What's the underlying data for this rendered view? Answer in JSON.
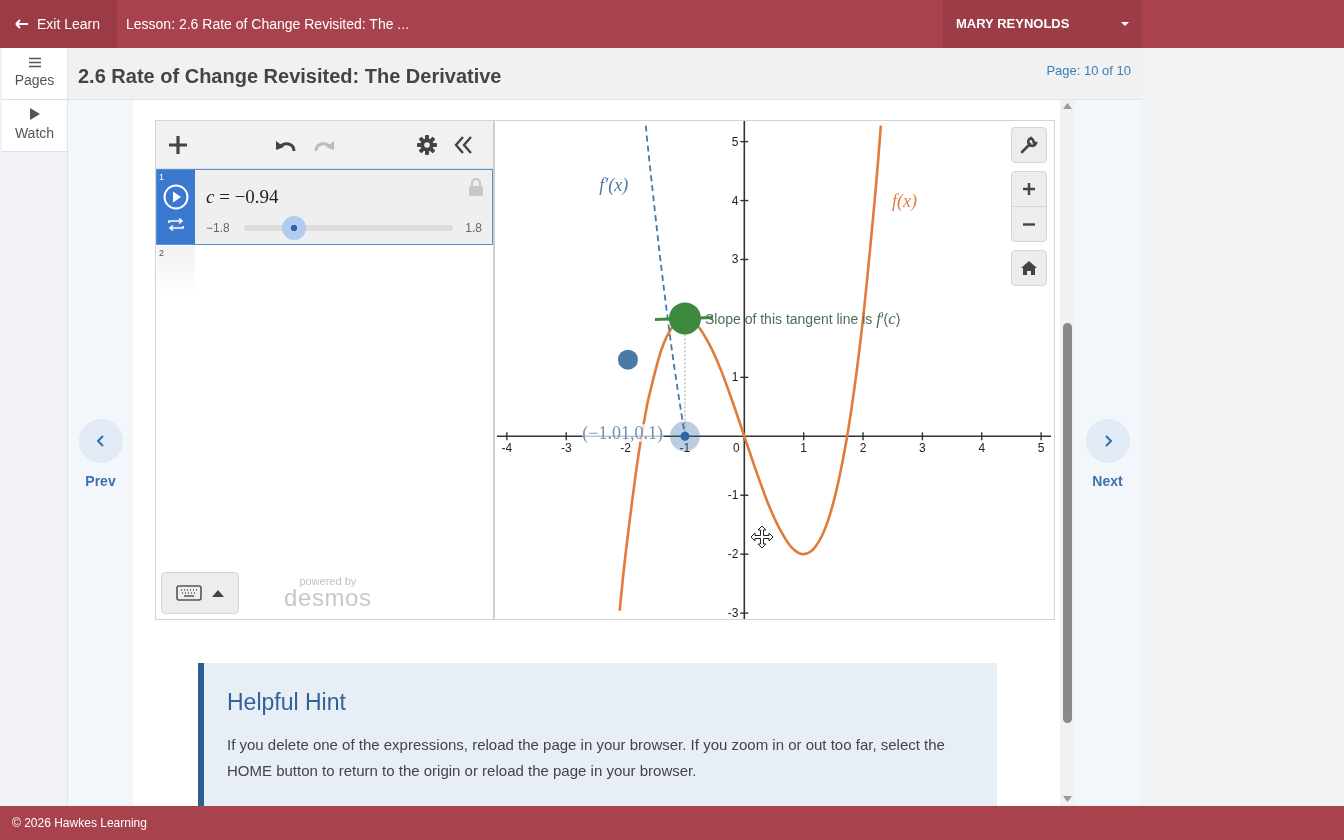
{
  "top_bar": {
    "exit_label": "Exit Learn",
    "lesson_title": "Lesson: 2.6 Rate of Change Revisited: The ...",
    "user_name": "MARY REYNOLDS"
  },
  "sidebar": {
    "items": [
      {
        "label": "Pages",
        "kind": "menu"
      },
      {
        "label": "Watch",
        "kind": "play"
      }
    ]
  },
  "header": {
    "title": "2.6 Rate of Change Revisited: The Derivative",
    "page_indicator": "Page: 10 of 10"
  },
  "navigation": {
    "prev": "Prev",
    "next": "Next"
  },
  "calculator": {
    "expressions": [
      {
        "index": "1",
        "kind": "slider",
        "selected": true,
        "latex": "*c* = −0.94",
        "min": "−1.8",
        "max": "1.8",
        "level": 0.24,
        "locked": true
      },
      {
        "index": "2",
        "kind": "empty",
        "selected": false
      }
    ],
    "powered_by": "powered by",
    "brand": "desmos",
    "chart_data": {
      "type": "line",
      "x": [
        -2.1,
        -2.0,
        -1.8,
        -1.66,
        -1.6,
        -1.4,
        -1.2,
        -1.0,
        -0.8,
        -0.6,
        -0.4,
        -0.2,
        0,
        0.2,
        0.4,
        0.6,
        0.8,
        1.0,
        1.2,
        1.4,
        1.6,
        1.8,
        2.0,
        2.2,
        2.3
      ],
      "series": [
        {
          "name": "f(x)",
          "color": "#e07b39",
          "values": [
            -2.96,
            -2,
            -0.43,
            0.41,
            0.7,
            1.46,
            1.87,
            2,
            1.89,
            1.58,
            1.14,
            0.59,
            0,
            -0.59,
            -1.14,
            -1.58,
            -1.89,
            -2,
            -1.87,
            -1.46,
            -0.7,
            0.43,
            2,
            4.05,
            5.27
          ]
        },
        {
          "name": "f′(x)",
          "color": "#4a77a4",
          "line_style": "dashed",
          "values": [
            null,
            null,
            null,
            5.27,
            4.68,
            2.88,
            1.32,
            0,
            null,
            null,
            null,
            null,
            null,
            null,
            null,
            null,
            null,
            null,
            null,
            null,
            null,
            null,
            null,
            null,
            null
          ]
        }
      ],
      "xlim": [
        -4.2,
        5.2
      ],
      "ylim": [
        -3.1,
        5.35
      ],
      "xticks": [
        -4,
        -3,
        -2,
        -1,
        0,
        1,
        2,
        3,
        4,
        5
      ],
      "yticks": [
        -3,
        -2,
        -1,
        1,
        3,
        4,
        5
      ],
      "annotations": [
        "Slope of this tangent line is *f*′(*c*)",
        "(−1.01,0.1)"
      ]
    }
  },
  "hint": {
    "title": "Helpful Hint",
    "text": "If you delete one of the expressions, reload the page in your browser. If you zoom in or out too far, select the HOME button to return to the origin or reload the page in your browser."
  },
  "footer": "© 2026 Hawkes Learning"
}
